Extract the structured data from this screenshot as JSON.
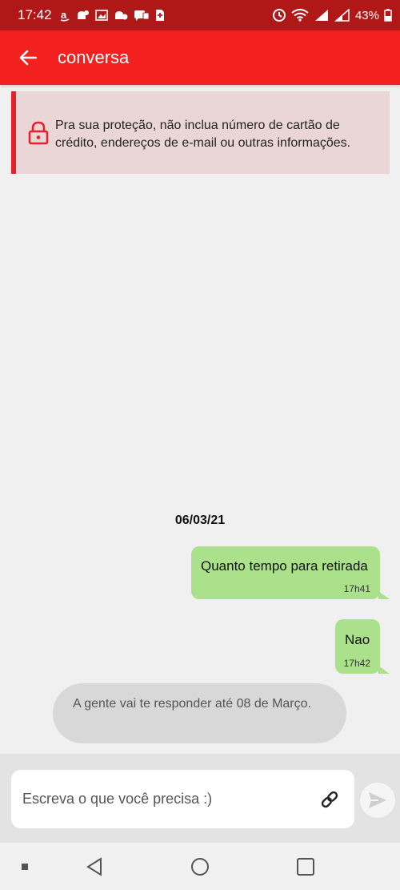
{
  "status_bar": {
    "time": "17:42",
    "battery_percent": "43%",
    "icons": [
      "amazon-icon",
      "notification-icon",
      "gallery-icon",
      "notification-icon",
      "chat-icon",
      "sim-icon",
      "sync-icon",
      "wifi-icon",
      "signal-icon",
      "signal-icon",
      "battery-icon"
    ]
  },
  "app_bar": {
    "title": "conversa",
    "color": "#f32020"
  },
  "warning": {
    "text": "Pra sua proteção, não inclua número de cartão de crédito, endereços de e-mail ou outras informações.",
    "accent_color": "#e8202a"
  },
  "chat": {
    "date": "06/03/21",
    "messages": [
      {
        "direction": "out",
        "text": "Quanto tempo para retirada",
        "time": "17h41"
      },
      {
        "direction": "out",
        "text": "Nao",
        "time": "17h42"
      },
      {
        "direction": "in",
        "text": "A gente vai te responder até 08 de Março."
      }
    ]
  },
  "composer": {
    "placeholder": "Escreva o que você precisa :)"
  },
  "nav": [
    "recents-dot",
    "back",
    "home",
    "overview"
  ]
}
